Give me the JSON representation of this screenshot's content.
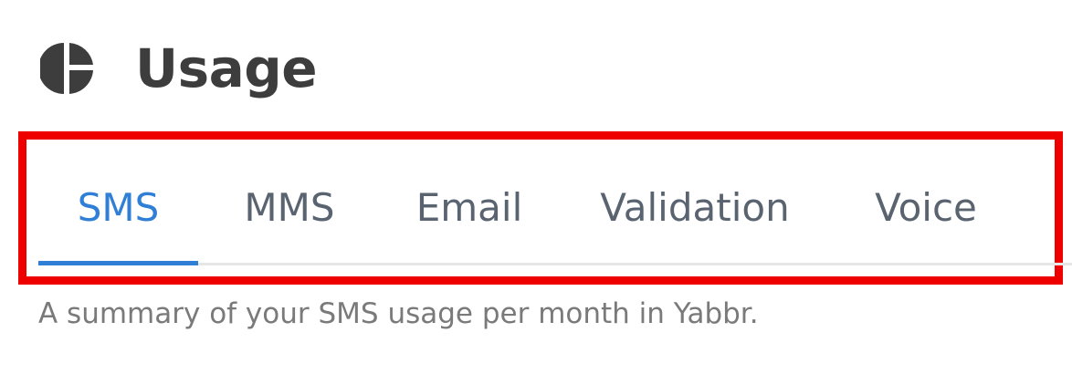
{
  "header": {
    "icon": "pie-chart-icon",
    "title": "Usage"
  },
  "tabs": [
    {
      "label": "SMS",
      "active": true
    },
    {
      "label": "MMS",
      "active": false
    },
    {
      "label": "Email",
      "active": false
    },
    {
      "label": "Validation",
      "active": false
    },
    {
      "label": "Voice",
      "active": false
    }
  ],
  "summary": {
    "text": "A summary of your SMS usage per month in Yabbr."
  },
  "colors": {
    "active_tab": "#2f7fd6",
    "inactive_tab": "#5a6370",
    "title": "#3d3d3d",
    "highlight_border": "#ee0000",
    "summary_text": "#7a7a7a"
  }
}
